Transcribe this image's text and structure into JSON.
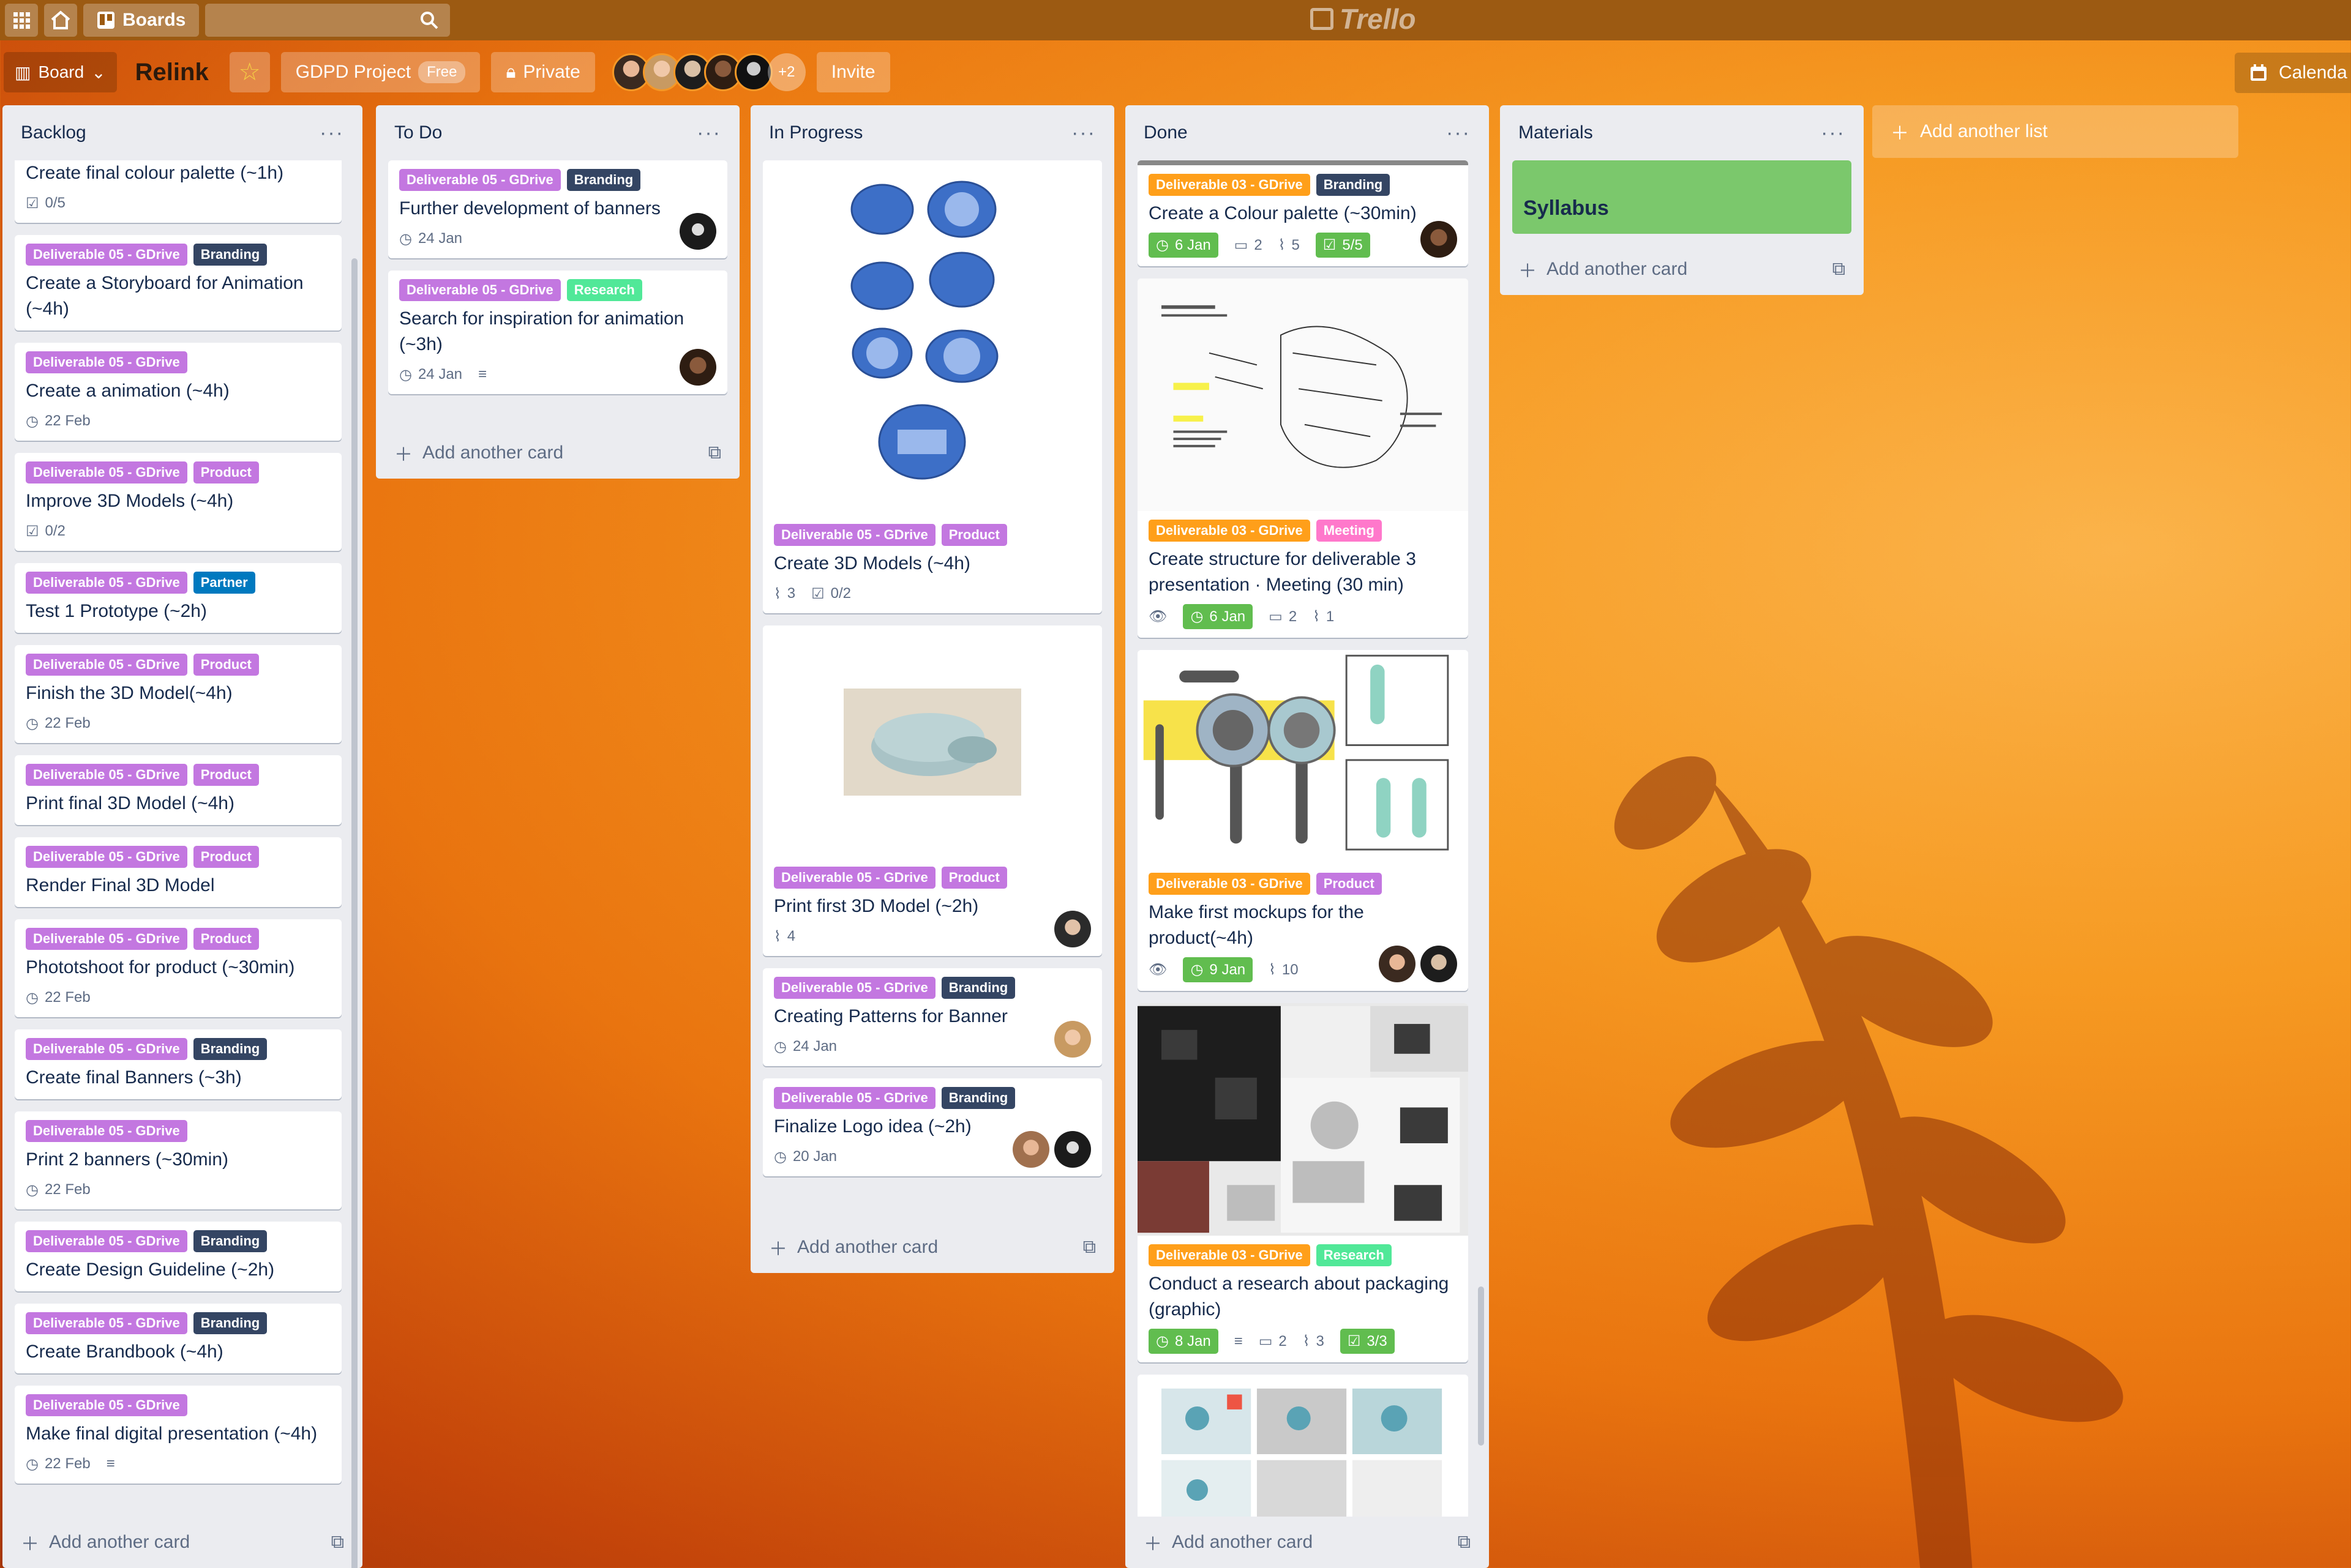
{
  "topbar": {
    "boards_label": "Boards",
    "logo_text": "Trello"
  },
  "header": {
    "board_view": "Board",
    "title": "Relink",
    "workspace": "GDPD Project",
    "workspace_badge": "Free",
    "visibility": "Private",
    "members_more": "+2",
    "invite": "Invite",
    "calendar": "Calenda"
  },
  "colors": {
    "purple": "#c377e0",
    "orange": "#ff9f1a",
    "dark": "#344563",
    "pink": "#ff78cb",
    "green": "#51e898",
    "blue": "#0079bf",
    "due_green": "#61bd4f"
  },
  "lists": {
    "backlog": {
      "title": "Backlog",
      "add_card": "Add another card",
      "cards": [
        {
          "title": "Create final colour palette (~1h)",
          "checklist": "0/5"
        },
        {
          "l1": "Deliverable 05 - GDrive",
          "l2": "Branding",
          "title": "Create a Storyboard for Animation (~4h)"
        },
        {
          "l1": "Deliverable 05 - GDrive",
          "title": "Create a animation (~4h)",
          "due": "22 Feb"
        },
        {
          "l1": "Deliverable 05 - GDrive",
          "l2": "Product",
          "title": "Improve 3D Models (~4h)",
          "checklist": "0/2"
        },
        {
          "l1": "Deliverable 05 - GDrive",
          "l2": "Partner",
          "title": "Test 1 Prototype (~2h)"
        },
        {
          "l1": "Deliverable 05 - GDrive",
          "l2": "Product",
          "title": "Finish the 3D Model(~4h)",
          "due": "22 Feb"
        },
        {
          "l1": "Deliverable 05 - GDrive",
          "l2": "Product",
          "title": "Print final 3D Model (~4h)"
        },
        {
          "l1": "Deliverable 05 - GDrive",
          "l2": "Product",
          "title": "Render Final 3D Model"
        },
        {
          "l1": "Deliverable 05 - GDrive",
          "l2": "Product",
          "title": "Phototshoot for product (~30min)",
          "due": "22 Feb"
        },
        {
          "l1": "Deliverable 05 - GDrive",
          "l2": "Branding",
          "title": "Create final Banners (~3h)"
        },
        {
          "l1": "Deliverable 05 - GDrive",
          "title": "Print 2 banners (~30min)",
          "due": "22 Feb"
        },
        {
          "l1": "Deliverable 05 - GDrive",
          "l2": "Branding",
          "title": "Create Design Guideline (~2h)"
        },
        {
          "l1": "Deliverable 05 - GDrive",
          "l2": "Branding",
          "title": "Create Brandbook (~4h)"
        },
        {
          "l1": "Deliverable 05 - GDrive",
          "title": "Make final digital presentation (~4h)",
          "due": "22 Feb"
        }
      ]
    },
    "todo": {
      "title": "To Do",
      "add_card": "Add another card",
      "cards": [
        {
          "l1": "Deliverable 05 - GDrive",
          "l2": "Branding",
          "title": "Further development of banners",
          "due": "24 Jan"
        },
        {
          "l1": "Deliverable 05 - GDrive",
          "l2": "Research",
          "title": "Search for inspiration for animation (~3h)",
          "due": "24 Jan"
        }
      ]
    },
    "progress": {
      "title": "In Progress",
      "add_card": "Add another card",
      "cards": [
        {
          "l1": "Deliverable 05 - GDrive",
          "l2": "Product",
          "title": "Create 3D Models (~4h)",
          "attachments": "3",
          "checklist": "0/2"
        },
        {
          "l1": "Deliverable 05 - GDrive",
          "l2": "Product",
          "title": "Print first 3D Model (~2h)",
          "attachments": "4"
        },
        {
          "l1": "Deliverable 05 - GDrive",
          "l2": "Branding",
          "title": "Creating Patterns for Banner",
          "due": "24 Jan"
        },
        {
          "l1": "Deliverable 05 - GDrive",
          "l2": "Branding",
          "title": "Finalize Logo idea (~2h)",
          "due": "20 Jan"
        }
      ]
    },
    "done": {
      "title": "Done",
      "add_card": "Add another card",
      "cards": [
        {
          "l1": "Deliverable 03 - GDrive",
          "l2": "Branding",
          "title": "Create a Colour palette (~30min)",
          "due": "6 Jan",
          "comments": "2",
          "attachments": "5",
          "checklist": "5/5"
        },
        {
          "l1": "Deliverable 03 - GDrive",
          "l2": "Meeting",
          "title": "Create structure for deliverable 3 presentation · Meeting (30 min)",
          "due": "6 Jan",
          "comments": "2",
          "attachments": "1"
        },
        {
          "l1": "Deliverable 03 - GDrive",
          "l2": "Product",
          "title": "Make first mockups for the product(~4h)",
          "due": "9 Jan",
          "attachments": "10"
        },
        {
          "l1": "Deliverable 03 - GDrive",
          "l2": "Research",
          "title": "Conduct a research about packaging (graphic)",
          "due": "8 Jan",
          "comments": "2",
          "attachments": "3",
          "checklist": "3/3"
        }
      ]
    },
    "materials": {
      "title": "Materials",
      "add_card": "Add another card",
      "cards": [
        {
          "title": "Syllabus"
        }
      ]
    }
  },
  "add_list": "Add another list"
}
